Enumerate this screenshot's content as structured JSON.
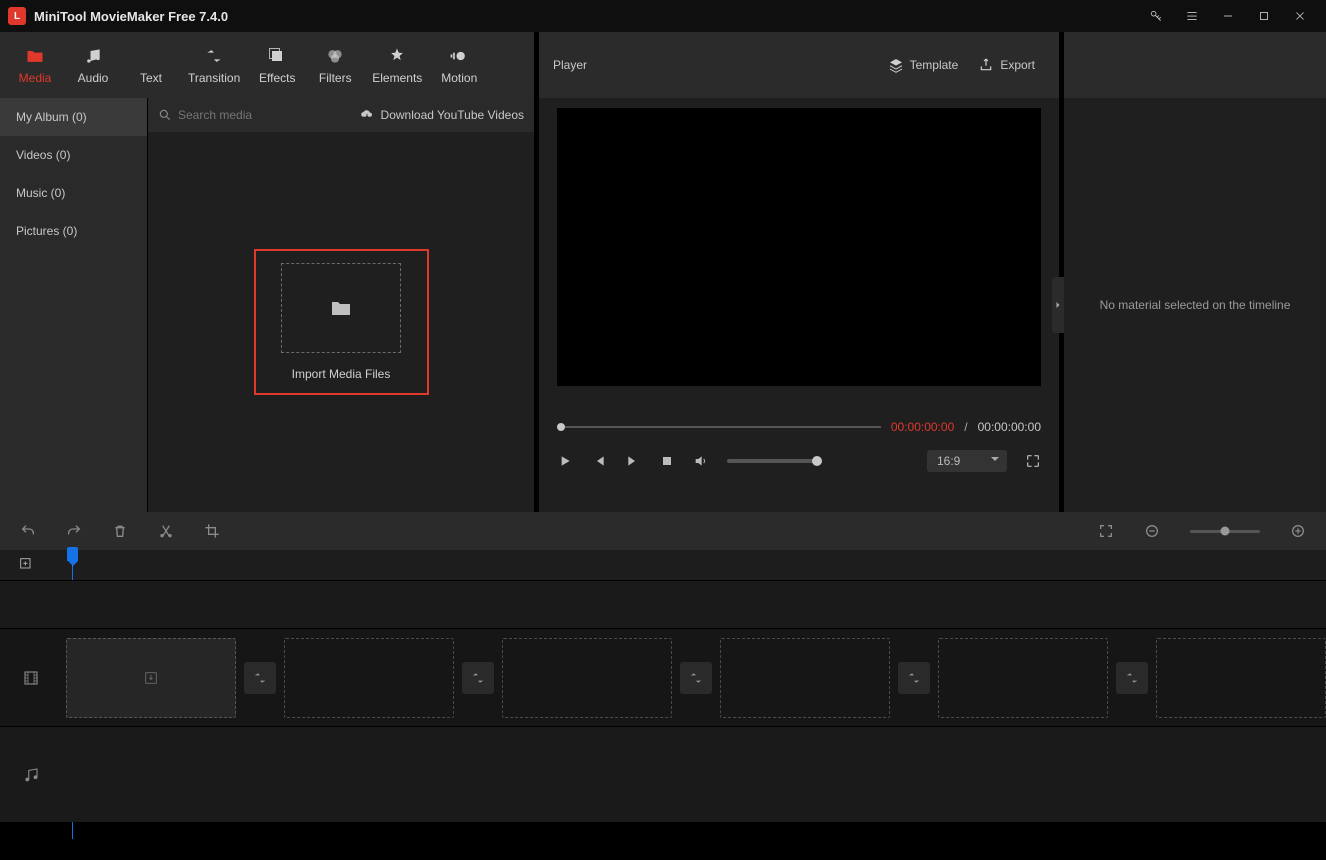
{
  "titlebar": {
    "title": "MiniTool MovieMaker Free 7.4.0"
  },
  "tabs": [
    {
      "label": "Media"
    },
    {
      "label": "Audio"
    },
    {
      "label": "Text"
    },
    {
      "label": "Transition"
    },
    {
      "label": "Effects"
    },
    {
      "label": "Filters"
    },
    {
      "label": "Elements"
    },
    {
      "label": "Motion"
    }
  ],
  "sidebar": {
    "items": [
      {
        "label": "My Album (0)"
      },
      {
        "label": "Videos (0)"
      },
      {
        "label": "Music (0)"
      },
      {
        "label": "Pictures (0)"
      }
    ]
  },
  "search": {
    "placeholder": "Search media"
  },
  "download_link": "Download YouTube Videos",
  "import_label": "Import Media Files",
  "player": {
    "title": "Player",
    "template": "Template",
    "export": "Export",
    "time_current": "00:00:00:00",
    "time_separator": "/",
    "time_total": "00:00:00:00",
    "aspect": "16:9"
  },
  "right_panel": {
    "message": "No material selected on the timeline"
  }
}
